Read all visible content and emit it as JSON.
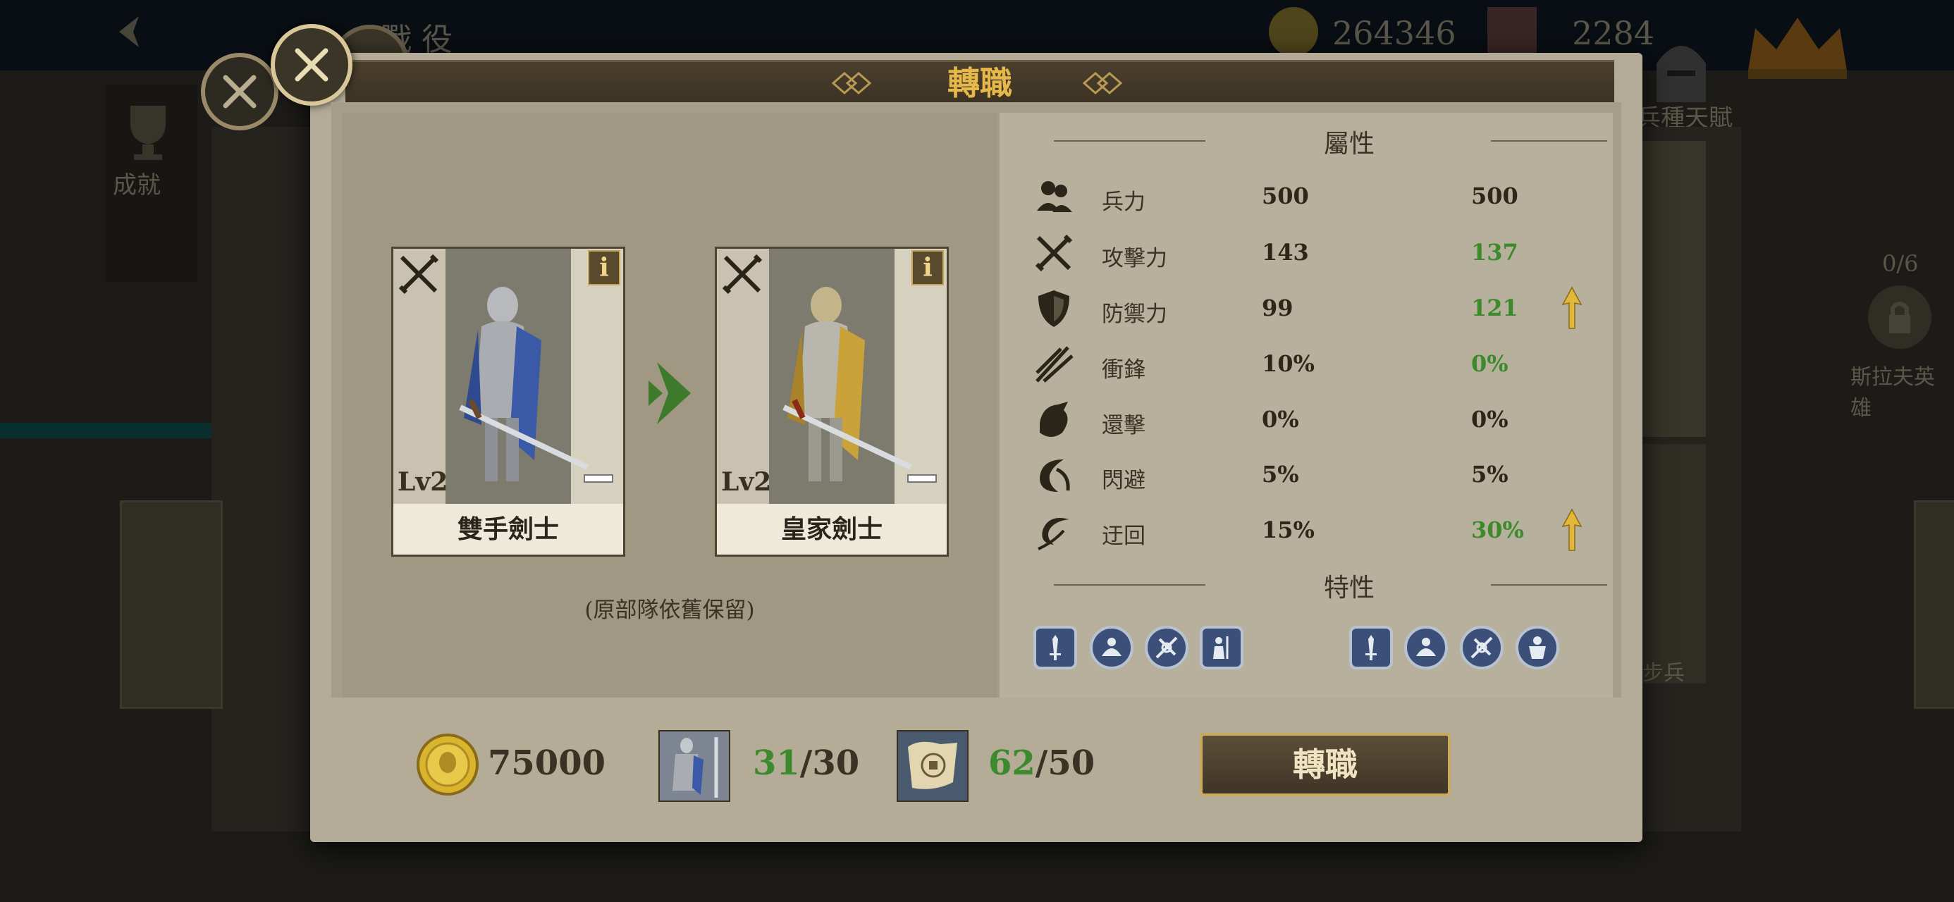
{
  "background": {
    "page_title": "戰 役",
    "gold": "264346",
    "gems": "2284",
    "achievement_label": "成就",
    "talent_label": "兵種天賦",
    "hero_progress": "0/6",
    "hero_name": "斯拉夫英雄",
    "bg_unit_tag": "步兵"
  },
  "dialog": {
    "title": "轉職",
    "close_icon": "close-icon",
    "from_unit": {
      "name": "雙手劍士",
      "level": "Lv2",
      "info_label": "i",
      "color": "#3a5aa8"
    },
    "to_unit": {
      "name": "皇家劍士",
      "level": "Lv2",
      "info_label": "i",
      "color": "#c9a23a"
    },
    "retain_note": "(原部隊依舊保留)",
    "attributes_title": "屬性",
    "traits_title": "特性",
    "stats": [
      {
        "icon": "troops-icon",
        "name": "兵力",
        "from": "500",
        "to": "500",
        "improved": false
      },
      {
        "icon": "attack-icon",
        "name": "攻擊力",
        "from": "143",
        "to": "137",
        "improved": false
      },
      {
        "icon": "defense-icon",
        "name": "防禦力",
        "from": "99",
        "to": "121",
        "improved": true
      },
      {
        "icon": "charge-icon",
        "name": "衝鋒",
        "from": "10%",
        "to": "0%",
        "improved": false
      },
      {
        "icon": "counter-icon",
        "name": "還擊",
        "from": "0%",
        "to": "0%",
        "improved": false
      },
      {
        "icon": "dodge-icon",
        "name": "閃避",
        "from": "5%",
        "to": "5%",
        "improved": false
      },
      {
        "icon": "flank-icon",
        "name": "迂回",
        "from": "15%",
        "to": "30%",
        "improved": true
      }
    ],
    "from_traits": [
      "sword-trait-icon",
      "rally-trait-icon",
      "shield-break-trait-icon",
      "guard-trait-icon"
    ],
    "to_traits": [
      "sword-trait-icon",
      "rally-trait-icon",
      "shield-break-trait-icon",
      "armor-trait-icon"
    ],
    "costs": {
      "gold": "75000",
      "units_have": "31",
      "units_need": "/30",
      "scrolls_have": "62",
      "scrolls_need": "/50"
    },
    "convert_button": "轉職",
    "colors": {
      "accent_gold": "#e6b84a",
      "value_up": "#3c8a2c",
      "trait_blue": "#3b4f78"
    }
  }
}
